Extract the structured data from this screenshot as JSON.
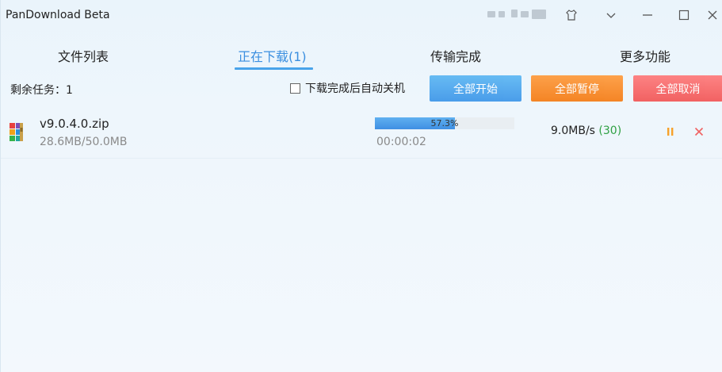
{
  "window": {
    "title": "PanDownload Beta",
    "controls": [
      "shirt-icon",
      "chevron-down-icon",
      "minimize-icon",
      "maximize-icon",
      "close-icon"
    ]
  },
  "tabs": [
    {
      "label": "文件列表",
      "active": false
    },
    {
      "label": "正在下载(1)",
      "active": true
    },
    {
      "label": "传输完成",
      "active": false
    },
    {
      "label": "更多功能",
      "active": false
    }
  ],
  "toolbar": {
    "remaining_tasks": "剩余任务：1",
    "auto_shutdown_label": "下载完成后自动关机",
    "auto_shutdown_checked": false,
    "start_all": "全部开始",
    "pause_all": "全部暂停",
    "cancel_all": "全部取消"
  },
  "downloads": [
    {
      "name": "v9.0.4.0.zip",
      "size": "28.6MB/50.0MB",
      "progress_text": "57.3%",
      "progress": 0.573,
      "elapsed": "00:00:02",
      "speed": "9.0MB/s",
      "connections": "(30)"
    }
  ],
  "colors": {
    "accent": "#3b8fe0",
    "start_button": "#4aa6ee",
    "pause_button": "#f7881f",
    "cancel_button": "#f46464",
    "connections_green": "#2ea043"
  }
}
